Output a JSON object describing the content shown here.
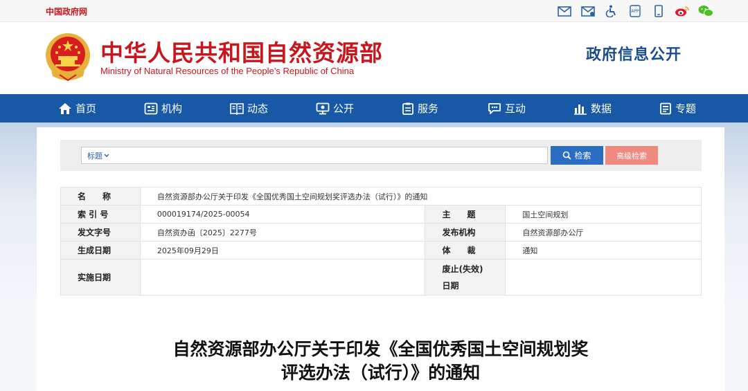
{
  "topbar": {
    "gov_link": "中国政府网",
    "tools": [
      {
        "icon": "mail-icon"
      },
      {
        "icon": "mail-reply-icon"
      },
      {
        "icon": "accessibility-icon"
      },
      {
        "icon": "app-icon",
        "label": "APP"
      },
      {
        "icon": "mobile-icon"
      },
      {
        "icon": "weibo-icon"
      },
      {
        "icon": "wechat-icon"
      }
    ]
  },
  "header": {
    "title": "中华人民共和国自然资源部",
    "subtitle": "Ministry of Natural Resources of the People’s Republic of China",
    "section_title": "政府信息公开"
  },
  "nav": {
    "items": [
      {
        "label": "首页",
        "icon": "home-icon"
      },
      {
        "label": "机构",
        "icon": "organization-icon"
      },
      {
        "label": "动态",
        "icon": "news-icon"
      },
      {
        "label": "公开",
        "icon": "disclosure-icon"
      },
      {
        "label": "服务",
        "icon": "service-icon"
      },
      {
        "label": "互动",
        "icon": "interact-icon"
      },
      {
        "label": "数据",
        "icon": "data-icon"
      },
      {
        "label": "专题",
        "icon": "topic-icon"
      }
    ]
  },
  "search": {
    "select_value": "标题",
    "input_value": "",
    "search_label": "检索",
    "advanced_label": "高级检索"
  },
  "info": {
    "name_label": "名　　称",
    "name_value": "自然资源部办公厅关于印发《全国优秀国土空间规划奖评选办法（试行）》的通知",
    "index_label": "索 引 号",
    "index_value": "000019174/2025-00054",
    "subject_label": "主　　题",
    "subject_value": "国土空间规划",
    "docnum_label": "发文字号",
    "docnum_value": "自然资办函〔2025〕2277号",
    "issuer_label": "发布机构",
    "issuer_value": "自然资源部办公厅",
    "created_label": "生成日期",
    "created_value": "2025年09月29日",
    "genre_label": "体　　裁",
    "genre_value": "通知",
    "effective_label": "实施日期",
    "effective_value": "",
    "expiry_label_line1": "废止(失效)",
    "expiry_label_line2": "日期",
    "expiry_value": ""
  },
  "document": {
    "title_line1": "自然资源部办公厅关于印发《全国优秀国土空间规划奖",
    "title_line2": "评选办法（试行）》的通知"
  },
  "colors": {
    "brand_red": "#c8161e",
    "nav_blue": "#1759a6",
    "search_blue": "#2c6dc4",
    "advanced_pink": "#ef8a80"
  }
}
